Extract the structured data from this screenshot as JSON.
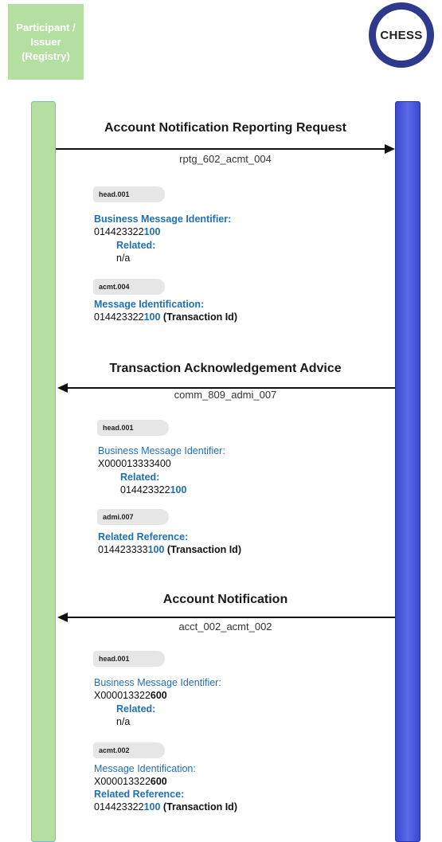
{
  "participant_label": "Participant / Issuer (Registry)",
  "chess_logo_text": "CHESS",
  "colors": {
    "participant_green": "#b5dfa0",
    "chess_blue": "#3a48d0",
    "label_blue": "#1f6fb5"
  },
  "messages": [
    {
      "title": "Account Notification Reporting Request",
      "code": "rptg_602_acmt_004",
      "direction": "to-chess",
      "head_tag": "head.001",
      "bmi_label": "Business Message Identifier:",
      "bmi_prefix": "014423322",
      "bmi_suffix": "100",
      "related_label": "Related:",
      "related_value": "n/a",
      "body_tag": "acmt.004",
      "field1_label": "Message Identification:",
      "field1_prefix": "014423322",
      "field1_suffix": "100",
      "field1_note": " (Transaction Id)"
    },
    {
      "title": "Transaction Acknowledgement Advice",
      "code": "comm_809_admi_007",
      "direction": "to-participant",
      "head_tag": "head.001",
      "bmi_label": "Business Message Identifier:",
      "bmi_value": "X000013333400",
      "related_label": "Related:",
      "related_prefix": "014423322",
      "related_suffix": "100",
      "body_tag": "admi.007",
      "field1_label": "Related Reference:",
      "field1_prefix": "014423333",
      "field1_suffix": "100",
      "field1_note": " (Transaction Id)"
    },
    {
      "title": "Account Notification",
      "code": "acct_002_acmt_002",
      "direction": "to-participant",
      "head_tag": "head.001",
      "bmi_label": "Business Message Identifier:",
      "bmi_prefix": "X000013322",
      "bmi_suffix": "600",
      "related_label": "Related:",
      "related_value": "n/a",
      "body_tag": "acmt.002",
      "field1_label": "Message Identification:",
      "field1_prefix": "X000013322",
      "field1_suffix": "600",
      "field2_label": "Related Reference:",
      "field2_prefix": "014423322",
      "field2_suffix": "100",
      "field2_note": " (Transaction Id)"
    }
  ]
}
